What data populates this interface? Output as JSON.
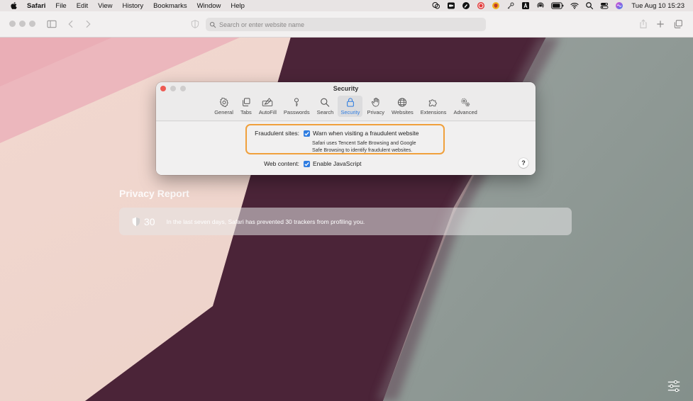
{
  "menubar": {
    "app": "Safari",
    "items": [
      "File",
      "Edit",
      "View",
      "History",
      "Bookmarks",
      "Window",
      "Help"
    ],
    "clock": "Tue Aug 10  15:23"
  },
  "toolbar": {
    "search_placeholder": "Search or enter website name"
  },
  "privacy_report": {
    "title": "Privacy Report",
    "count": "30",
    "text": "In the last seven days, Safari has prevented 30 trackers from profiling you."
  },
  "prefs": {
    "title": "Security",
    "tabs": [
      {
        "label": "General",
        "icon": "gear-icon"
      },
      {
        "label": "Tabs",
        "icon": "tabs-icon"
      },
      {
        "label": "AutoFill",
        "icon": "autofill-icon"
      },
      {
        "label": "Passwords",
        "icon": "key-icon"
      },
      {
        "label": "Search",
        "icon": "search-icon"
      },
      {
        "label": "Security",
        "icon": "lock-icon"
      },
      {
        "label": "Privacy",
        "icon": "hand-icon"
      },
      {
        "label": "Websites",
        "icon": "globe-icon"
      },
      {
        "label": "Extensions",
        "icon": "puzzle-icon"
      },
      {
        "label": "Advanced",
        "icon": "gears-icon"
      }
    ],
    "active_tab": "Security",
    "fraudulent": {
      "label": "Fraudulent sites:",
      "checkbox": "Warn when visiting a fraudulent website",
      "desc_line1": "Safari uses Tencent Safe Browsing and Google",
      "desc_line2": "Safe Browsing to identify fraudulent websites."
    },
    "web_content": {
      "label": "Web content:",
      "checkbox": "Enable JavaScript"
    },
    "help": "?"
  },
  "colors": {
    "accent": "#2f7de1",
    "highlight": "#f0a03c",
    "bg_pink": "#eab9bf",
    "bg_cream": "#efd5cc",
    "bg_plum": "#4a2538",
    "bg_gray": "#8f9a95"
  }
}
